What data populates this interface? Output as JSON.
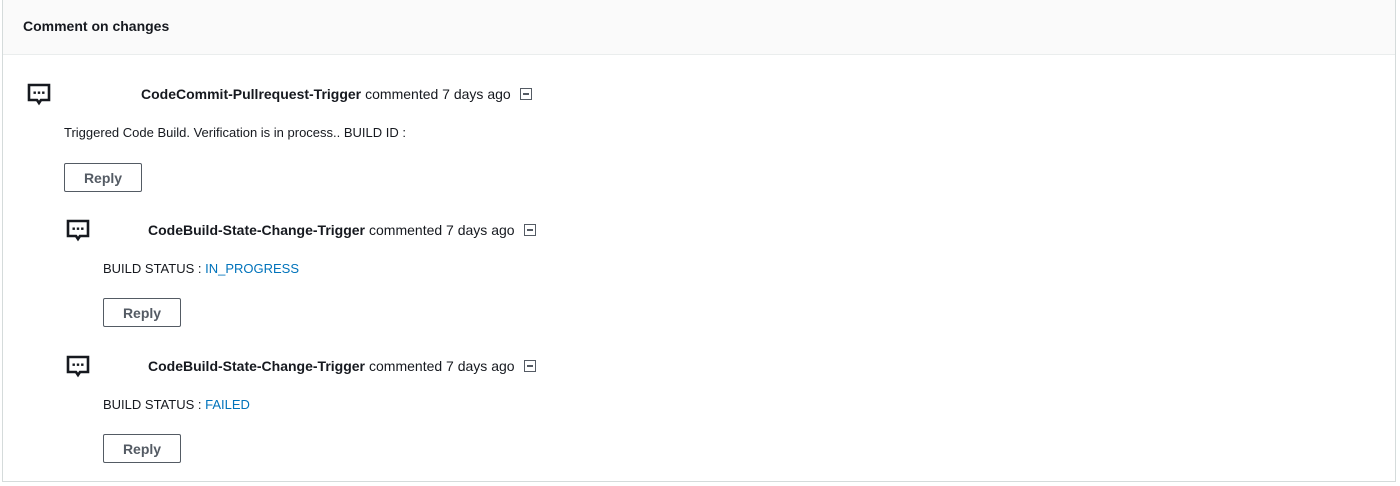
{
  "panel": {
    "title": "Comment on changes"
  },
  "comments": [
    {
      "author": "CodeCommit-Pullrequest-Trigger",
      "meta": "commented 7 days ago",
      "body_prefix": "Triggered Code Build. Verification is in process.. BUILD ID :",
      "body_value": "",
      "reply_label": "Reply"
    },
    {
      "author": "CodeBuild-State-Change-Trigger",
      "meta": "commented 7 days ago",
      "body_prefix": "BUILD STATUS : ",
      "body_value": "IN_PROGRESS",
      "reply_label": "Reply"
    },
    {
      "author": "CodeBuild-State-Change-Trigger",
      "meta": "commented 7 days ago",
      "body_prefix": "BUILD STATUS : ",
      "body_value": "FAILED",
      "reply_label": "Reply"
    }
  ],
  "icons": {
    "avatar": "comment-bubble-icon",
    "collapse": "collapse-minus-icon"
  },
  "colors": {
    "status_link": "#0073bb",
    "header_bg": "#fafafa"
  }
}
